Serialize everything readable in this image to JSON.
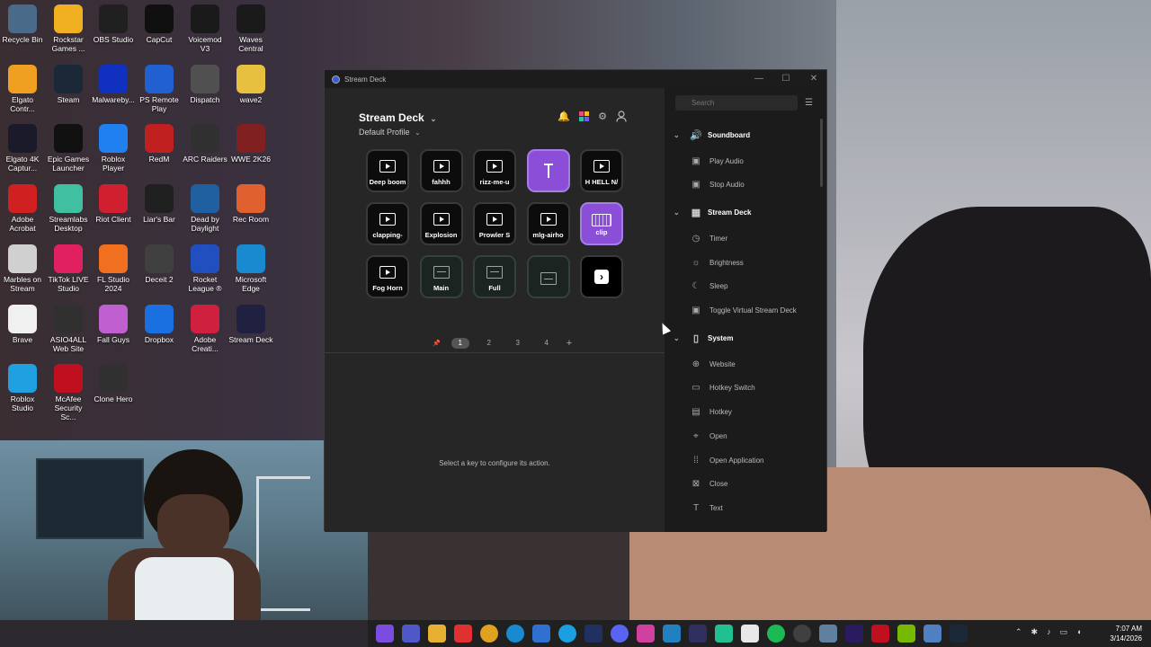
{
  "desktop": {
    "icons": [
      {
        "label": "Recycle Bin",
        "icon": "recycle-bin-icon",
        "color": "#4a6a8a"
      },
      {
        "label": "Rockstar Games ...",
        "icon": "rockstar-icon",
        "color": "#f0b020"
      },
      {
        "label": "OBS Studio",
        "icon": "obs-icon",
        "color": "#202020"
      },
      {
        "label": "CapCut",
        "icon": "capcut-icon",
        "color": "#101010"
      },
      {
        "label": "Voicemod V3",
        "icon": "voicemod-icon",
        "color": "#1a1a1a"
      },
      {
        "label": "Waves Central",
        "icon": "waves-icon",
        "color": "#1a1a1a"
      },
      {
        "label": "Elgato Contr...",
        "icon": "elgato-icon",
        "color": "#f0a020"
      },
      {
        "label": "Steam",
        "icon": "steam-icon",
        "color": "#1b2838"
      },
      {
        "label": "Malwareby...",
        "icon": "malwarebytes-icon",
        "color": "#1030c0"
      },
      {
        "label": "PS Remote Play",
        "icon": "ps-remote-icon",
        "color": "#2060d0"
      },
      {
        "label": "Dispatch",
        "icon": "dispatch-icon",
        "color": "#505050"
      },
      {
        "label": "wave2",
        "icon": "folder-icon",
        "color": "#e8c040"
      },
      {
        "label": "Elgato 4K Captur...",
        "icon": "elgato-4k-icon",
        "color": "#1a1a2a"
      },
      {
        "label": "Epic Games Launcher",
        "icon": "epic-icon",
        "color": "#111"
      },
      {
        "label": "Roblox Player",
        "icon": "roblox-icon",
        "color": "#2080f0"
      },
      {
        "label": "RedM",
        "icon": "redm-icon",
        "color": "#c02020"
      },
      {
        "label": "ARC Raiders",
        "icon": "arc-raiders-icon",
        "color": "#303030"
      },
      {
        "label": "WWE 2K26",
        "icon": "wwe-icon",
        "color": "#802020"
      },
      {
        "label": "Adobe Acrobat",
        "icon": "acrobat-icon",
        "color": "#d02020"
      },
      {
        "label": "Streamlabs Desktop",
        "icon": "streamlabs-icon",
        "color": "#40c0a0"
      },
      {
        "label": "Riot Client",
        "icon": "riot-icon",
        "color": "#d02030"
      },
      {
        "label": "Liar's Bar",
        "icon": "liars-bar-icon",
        "color": "#202020"
      },
      {
        "label": "Dead by Daylight",
        "icon": "dbd-icon",
        "color": "#2060a0"
      },
      {
        "label": "Rec Room",
        "icon": "rec-room-icon",
        "color": "#e06030"
      },
      {
        "label": "Marbles on Stream",
        "icon": "marbles-icon",
        "color": "#d0d0d0"
      },
      {
        "label": "TikTok LIVE Studio",
        "icon": "tiktok-icon",
        "color": "#e02060"
      },
      {
        "label": "FL Studio 2024",
        "icon": "fl-studio-icon",
        "color": "#f07020"
      },
      {
        "label": "Deceit 2",
        "icon": "deceit-icon",
        "color": "#404040"
      },
      {
        "label": "Rocket League ®",
        "icon": "rocket-league-icon",
        "color": "#2050c0"
      },
      {
        "label": "Microsoft Edge",
        "icon": "edge-icon",
        "color": "#1a8ad0"
      },
      {
        "label": "Brave",
        "icon": "file-icon",
        "color": "#f0f0f0"
      },
      {
        "label": "ASIO4ALL Web Site",
        "icon": "asio-icon",
        "color": "#303030"
      },
      {
        "label": "Fall Guys",
        "icon": "fall-guys-icon",
        "color": "#c060d0"
      },
      {
        "label": "Dropbox",
        "icon": "dropbox-icon",
        "color": "#1a70e0"
      },
      {
        "label": "Adobe Creati...",
        "icon": "creative-cloud-icon",
        "color": "#d02040"
      },
      {
        "label": "Stream Deck",
        "icon": "stream-deck-icon",
        "color": "#202040"
      },
      {
        "label": "Roblox Studio",
        "icon": "roblox-studio-icon",
        "color": "#20a0e0"
      },
      {
        "label": "McAfee Security Sc...",
        "icon": "mcafee-icon",
        "color": "#c01020"
      },
      {
        "label": "Clone Hero",
        "icon": "clone-hero-icon",
        "color": "#303030"
      }
    ]
  },
  "window": {
    "title": "Stream Deck",
    "minimize": "—",
    "maximize": "☐",
    "close": "✕"
  },
  "header": {
    "device": "Stream Deck",
    "device_chevron": "⌄",
    "profile": "Default Profile",
    "profile_chevron": "⌄"
  },
  "keys": [
    {
      "label": "Deep boom",
      "style": "play"
    },
    {
      "label": "fahhh",
      "style": "play"
    },
    {
      "label": "rizz-me-u",
      "style": "play"
    },
    {
      "label": "",
      "style": "purple-mic"
    },
    {
      "label": "H HELL N/",
      "style": "play"
    },
    {
      "label": "clapping-",
      "style": "play"
    },
    {
      "label": "Explosion",
      "style": "play"
    },
    {
      "label": "Prowler S",
      "style": "play"
    },
    {
      "label": "mlg-airho",
      "style": "play"
    },
    {
      "label": "clip",
      "style": "purple-clip"
    },
    {
      "label": "Fog Horn",
      "style": "play"
    },
    {
      "label": "Main",
      "style": "folder"
    },
    {
      "label": "Full",
      "style": "folder"
    },
    {
      "label": "",
      "style": "folder"
    },
    {
      "label": "",
      "style": "next"
    }
  ],
  "pager": {
    "pin": "📌",
    "pages": [
      "1",
      "2",
      "3",
      "4"
    ],
    "active": 0,
    "add": "+"
  },
  "editor": {
    "hint": "Select a key to configure its action."
  },
  "actions_panel": {
    "search_placeholder": "Search",
    "categories": [
      {
        "name": "Soundboard",
        "icon": "speaker-icon",
        "glyph": "🔊",
        "actions": [
          {
            "name": "Play Audio",
            "icon": "play-audio-icon",
            "glyph": "▣"
          },
          {
            "name": "Stop Audio",
            "icon": "stop-audio-icon",
            "glyph": "▣"
          }
        ]
      },
      {
        "name": "Stream Deck",
        "icon": "stream-deck-grid-icon",
        "glyph": "▦",
        "actions": [
          {
            "name": "Timer",
            "icon": "timer-icon",
            "glyph": "◷"
          },
          {
            "name": "Brightness",
            "icon": "brightness-icon",
            "glyph": "☼"
          },
          {
            "name": "Sleep",
            "icon": "sleep-icon",
            "glyph": "☾"
          },
          {
            "name": "Toggle Virtual Stream Deck",
            "icon": "virtual-deck-icon",
            "glyph": "▣"
          }
        ]
      },
      {
        "name": "System",
        "icon": "system-icon",
        "glyph": "▯",
        "actions": [
          {
            "name": "Website",
            "icon": "globe-icon",
            "glyph": "⊕"
          },
          {
            "name": "Hotkey Switch",
            "icon": "hotkey-switch-icon",
            "glyph": "▭"
          },
          {
            "name": "Hotkey",
            "icon": "hotkey-icon",
            "glyph": "▤"
          },
          {
            "name": "Open",
            "icon": "open-icon",
            "glyph": "⌖"
          },
          {
            "name": "Open Application",
            "icon": "open-application-icon",
            "glyph": "⁞⁞"
          },
          {
            "name": "Close",
            "icon": "close-app-icon",
            "glyph": "⊠"
          },
          {
            "name": "Text",
            "icon": "text-icon",
            "glyph": "T"
          }
        ]
      }
    ]
  },
  "taskbar": {
    "clock_time": "7:07 AM",
    "clock_date": "3/14/2026"
  }
}
